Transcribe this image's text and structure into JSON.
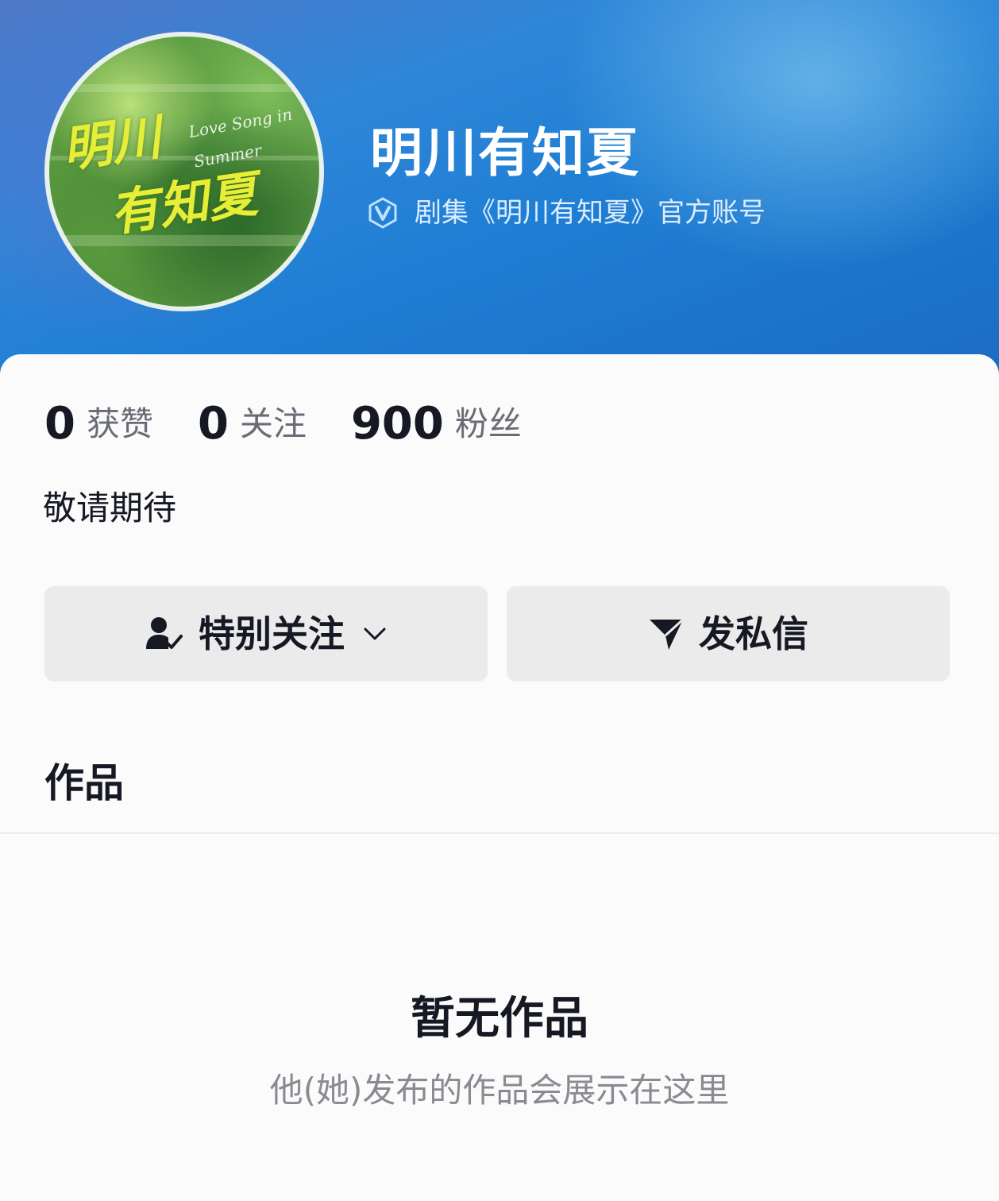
{
  "profile": {
    "name": "明川有知夏",
    "verified_label": "剧集《明川有知夏》官方账号",
    "avatar": {
      "logo_line1": "明川",
      "logo_line2": "有知夏",
      "logo_en": "Love Song in Summer"
    },
    "bio": "敬请期待"
  },
  "stats": [
    {
      "value": "0",
      "label": "获赞"
    },
    {
      "value": "0",
      "label": "关注"
    },
    {
      "value": "900",
      "label": "粉丝"
    }
  ],
  "actions": {
    "follow_label": "特别关注",
    "follow_icon": "user-check-icon",
    "message_label": "发私信",
    "message_icon": "send-icon"
  },
  "works": {
    "tab_label": "作品",
    "empty_title": "暂无作品",
    "empty_subtitle": "他(她)发布的作品会展示在这里"
  },
  "colors": {
    "header_blue": "#1f7fd4",
    "text_primary": "#161823",
    "text_secondary": "#6a6c75",
    "logo_yellow": "#e6ee37"
  }
}
